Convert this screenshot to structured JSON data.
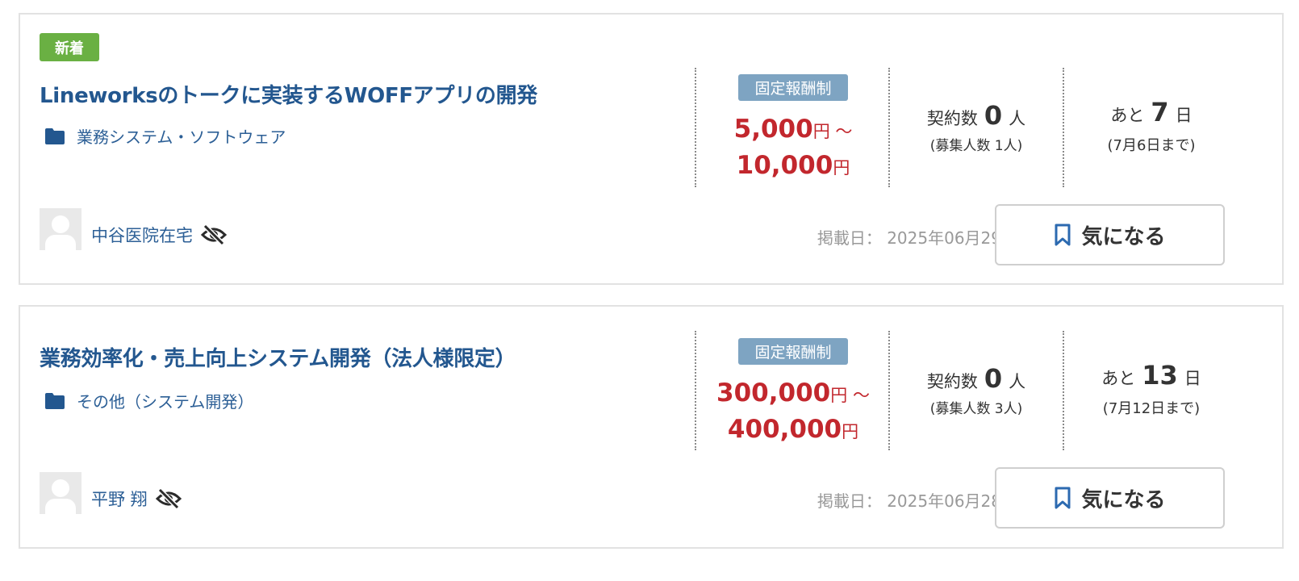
{
  "jobs": [
    {
      "badge": "新着",
      "title": "Lineworksのトークに実装するWOFFアプリの開発",
      "category": "業務システム・ソフトウェア",
      "pay_type": "固定報酬制",
      "price_min": "5,000",
      "price_max": "10,000",
      "price_unit": "円",
      "price_sep": "〜",
      "contract_prefix": "契約数",
      "contract_count": "0",
      "contract_suffix": "人",
      "recruit_text": "(募集人数 1人)",
      "deadline_prefix": "あと",
      "deadline_days": "7",
      "deadline_suffix": "日",
      "deadline_date": "(7月6日まで)",
      "client_name": "中谷医院在宅",
      "posted_date": "掲載日： 2025年06月29日",
      "fav_label": "気になる"
    },
    {
      "title": "業務効率化・売上向上システム開発（法人様限定）",
      "category": "その他（システム開発）",
      "pay_type": "固定報酬制",
      "price_min": "300,000",
      "price_max": "400,000",
      "price_unit": "円",
      "price_sep": "〜",
      "contract_prefix": "契約数",
      "contract_count": "0",
      "contract_suffix": "人",
      "recruit_text": "(募集人数 3人)",
      "deadline_prefix": "あと",
      "deadline_days": "13",
      "deadline_suffix": "日",
      "deadline_date": "(7月12日まで)",
      "client_name": "平野 翔",
      "posted_date": "掲載日： 2025年06月28日",
      "fav_label": "気になる"
    }
  ],
  "colors": {
    "new_badge": "#6ab043",
    "title": "#23578f",
    "price": "#c2272d",
    "pay_type_bg": "#7ea4c2",
    "card_border": "#e2e2e2"
  },
  "icons": {
    "category": "folder-icon",
    "client_hidden": "eye-off-icon",
    "favorite": "bookmark-icon",
    "avatar": "avatar-placeholder"
  }
}
